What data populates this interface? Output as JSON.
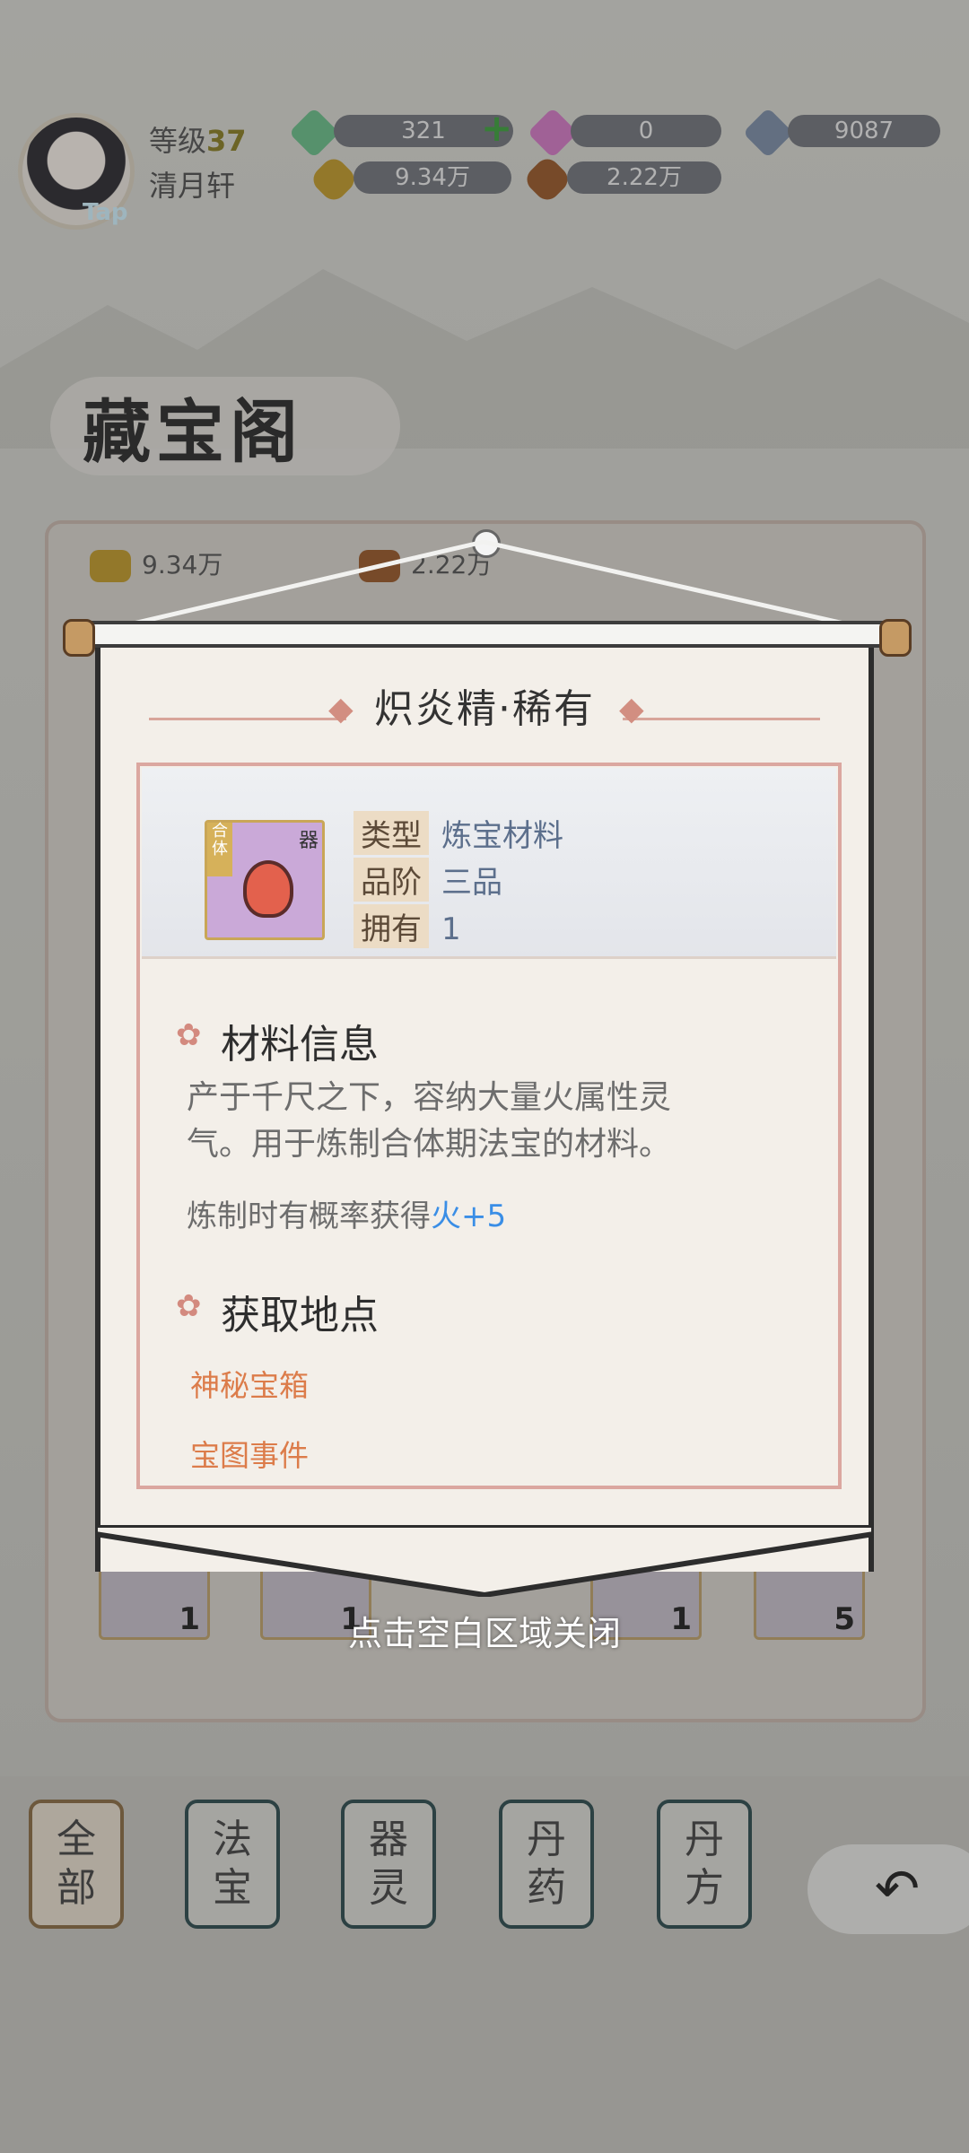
{
  "header": {
    "level_label": "等级",
    "level_value": "37",
    "player_name": "清月轩",
    "avatar_badge": "Tap",
    "currencies": [
      {
        "value": "321",
        "color": "#6bbf8a"
      },
      {
        "value": "0",
        "color": "#d47ac6"
      },
      {
        "value": "9087",
        "color": "#7d8fa8"
      },
      {
        "value": "9.34万",
        "color": "#c29b2b"
      },
      {
        "value": "2.22万",
        "color": "#9a5a2a"
      }
    ]
  },
  "page": {
    "title": "藏宝阁",
    "resources": [
      "9.34万",
      "2.22万"
    ]
  },
  "inventory_counts": [
    "1",
    "1",
    "1",
    "5"
  ],
  "modal": {
    "title": "炽炎精·稀有",
    "item_tag_left": "合体",
    "item_tag_right": "器",
    "info": [
      {
        "key": "类型",
        "value": "炼宝材料"
      },
      {
        "key": "品阶",
        "value": "三品"
      },
      {
        "key": "拥有",
        "value": "1"
      }
    ],
    "section_material": "材料信息",
    "description_line1": "产于千尺之下，容纳大量火属性灵",
    "description_line2": "气。用于炼制合体期法宝的材料。",
    "chance_prefix": "炼制时有概率获得",
    "chance_value": "火+5",
    "section_source": "获取地点",
    "sources": [
      "神秘宝箱",
      "宝图事件"
    ]
  },
  "close_hint": "点击空白区域关闭",
  "tabs": [
    {
      "line1": "全",
      "line2": "部"
    },
    {
      "line1": "法",
      "line2": "宝"
    },
    {
      "line1": "器",
      "line2": "灵"
    },
    {
      "line1": "丹",
      "line2": "药"
    },
    {
      "line1": "丹",
      "line2": "方"
    }
  ],
  "back_icon": "↶",
  "colors": {
    "accent_link": "#3a8ee6",
    "source_link": "#dc7c4a",
    "border": "#dba7a0"
  }
}
